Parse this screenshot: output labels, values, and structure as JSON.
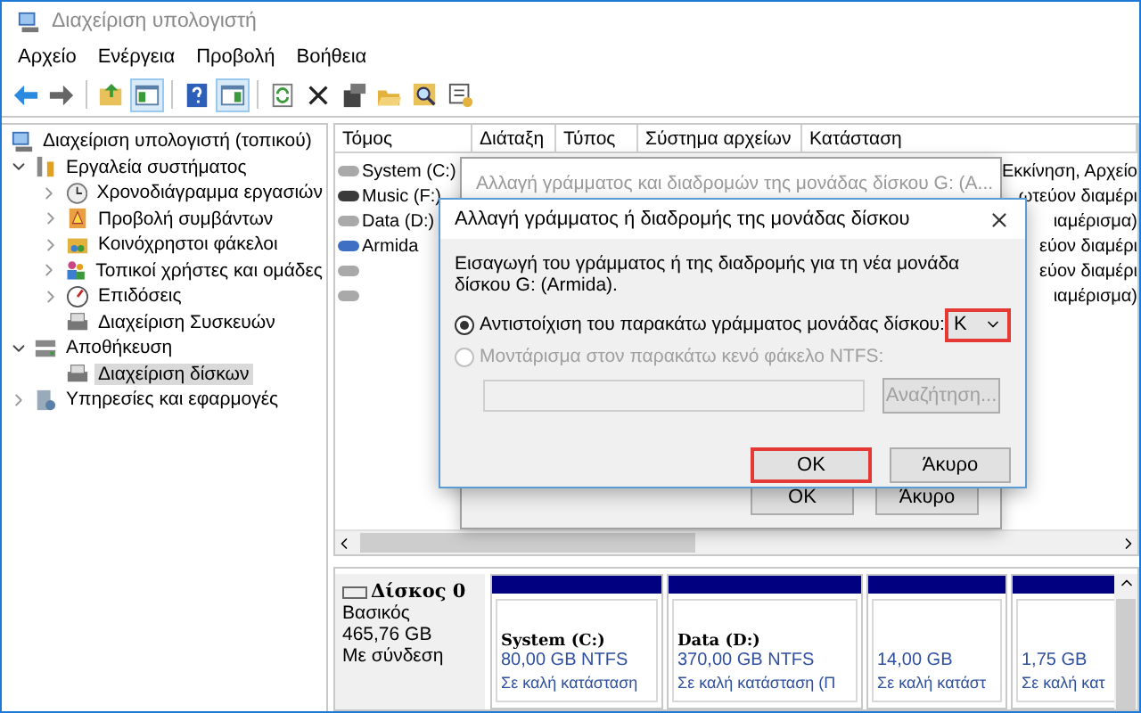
{
  "window": {
    "title": "Διαχείριση υπολογιστή"
  },
  "menu": [
    "Αρχείο",
    "Ενέργεια",
    "Προβολή",
    "Βοήθεια"
  ],
  "toolbar": [
    {
      "kind": "back",
      "pressed": false
    },
    {
      "kind": "forward",
      "pressed": false
    },
    {
      "kind": "separator"
    },
    {
      "kind": "up",
      "pressed": false
    },
    {
      "kind": "tree",
      "pressed": true
    },
    {
      "kind": "separator"
    },
    {
      "kind": "help",
      "pressed": false
    },
    {
      "kind": "pane",
      "pressed": true
    },
    {
      "kind": "separator"
    },
    {
      "kind": "refresh",
      "pressed": false
    },
    {
      "kind": "delete",
      "pressed": false
    },
    {
      "kind": "properties",
      "pressed": false
    },
    {
      "kind": "open",
      "pressed": false
    },
    {
      "kind": "search",
      "pressed": false
    },
    {
      "kind": "settings",
      "pressed": false
    }
  ],
  "tree": [
    {
      "label": "Διαχείριση υπολογιστή (τοπικού)",
      "kind": "computer",
      "selected": false,
      "children": [
        {
          "label": "Εργαλεία συστήματος",
          "kind": "tools",
          "expanded": true,
          "selected": false,
          "children": [
            {
              "label": "Χρονοδιάγραμμα εργασιών",
              "kind": "clock",
              "expanded": false,
              "selected": false
            },
            {
              "label": "Προβολή συμβάντων",
              "kind": "event",
              "expanded": false,
              "selected": false
            },
            {
              "label": "Κοινόχρηστοι φάκελοι",
              "kind": "share",
              "expanded": false,
              "selected": false
            },
            {
              "label": "Τοπικοί χρήστες και ομάδες",
              "kind": "users",
              "expanded": false,
              "selected": false
            },
            {
              "label": "Επιδόσεις",
              "kind": "performance",
              "expanded": false,
              "selected": false
            },
            {
              "label": "Διαχείριση Συσκευών",
              "kind": "devices",
              "selected": false
            }
          ]
        },
        {
          "label": "Αποθήκευση",
          "kind": "storage",
          "expanded": true,
          "selected": false,
          "children": [
            {
              "label": "Διαχείριση δίσκων",
              "kind": "devices",
              "selected": true
            }
          ]
        },
        {
          "label": "Υπηρεσίες και εφαρμογές",
          "kind": "services",
          "expanded": false,
          "selected": false
        }
      ]
    }
  ],
  "volumes": {
    "columns": [
      "Τόμος",
      "Διάταξη",
      "Τύπος",
      "Σύστημα αρχείων",
      "Κατάσταση"
    ],
    "rows": [
      {
        "name": "System (C:)",
        "color": "#a9a9a9",
        "status": "Εκκίνηση, Αρχείο"
      },
      {
        "name": "Music (F:)",
        "color": "#3a3a3a",
        "status": "ωτεύον διαμέρι"
      },
      {
        "name": "Data (D:)",
        "color": "#a9a9a9",
        "status": "ιαμέρισμα)"
      },
      {
        "name": "Armida",
        "color": "#3f6fc4",
        "status": "εύον διαμέρι"
      },
      {
        "color": "#a9a9a9",
        "status": "εύον διαμέρι"
      },
      {
        "color": "#a9a9a9",
        "status": "ιαμέρισμα)"
      }
    ]
  },
  "disk": {
    "name": "Δίσκος 0",
    "type": "Βασικός",
    "size": "465,76 GB",
    "state": "Με σύνδεση",
    "partitions": [
      {
        "name": "System  (C:)",
        "size": "80,00 GB NTFS",
        "status": "Σε καλή κατάσταση"
      },
      {
        "name": "Data  (D:)",
        "size": "370,00 GB NTFS",
        "status": "Σε καλή κατάσταση (Π"
      },
      {
        "size": "14,00 GB",
        "status": "Σε καλή κατάστ"
      },
      {
        "size": "1,75 GB",
        "status": "Σε καλή κατ"
      }
    ]
  },
  "back_dialog": {
    "title": "Αλλαγή γράμματος και διαδρομών της μονάδας δίσκου G: (A...",
    "buttons": [
      "OK",
      "Άκυρο"
    ]
  },
  "dialog": {
    "title": "Αλλαγή γράμματος ή διαδρομής της μονάδας δίσκου",
    "prompt": "Εισαγωγή του γράμματος ή της διαδρομής για τη νέα μονάδα δίσκου G: (Armida).",
    "options": [
      {
        "label": "Αντιστοίχιση του παρακάτω γράμματος μονάδας δίσκου:",
        "selected": true,
        "disabled": false
      },
      {
        "label": "Μοντάρισμα στον παρακάτω κενό φάκελο NTFS:",
        "selected": false,
        "disabled": true
      }
    ],
    "letter": {
      "value": "K",
      "highlighted": true
    },
    "browse": {
      "label": "Αναζήτηση...",
      "disabled": true
    },
    "buttons": [
      {
        "label": "OK",
        "highlighted": true
      },
      {
        "label": "Άκυρο",
        "highlighted": false
      }
    ]
  }
}
